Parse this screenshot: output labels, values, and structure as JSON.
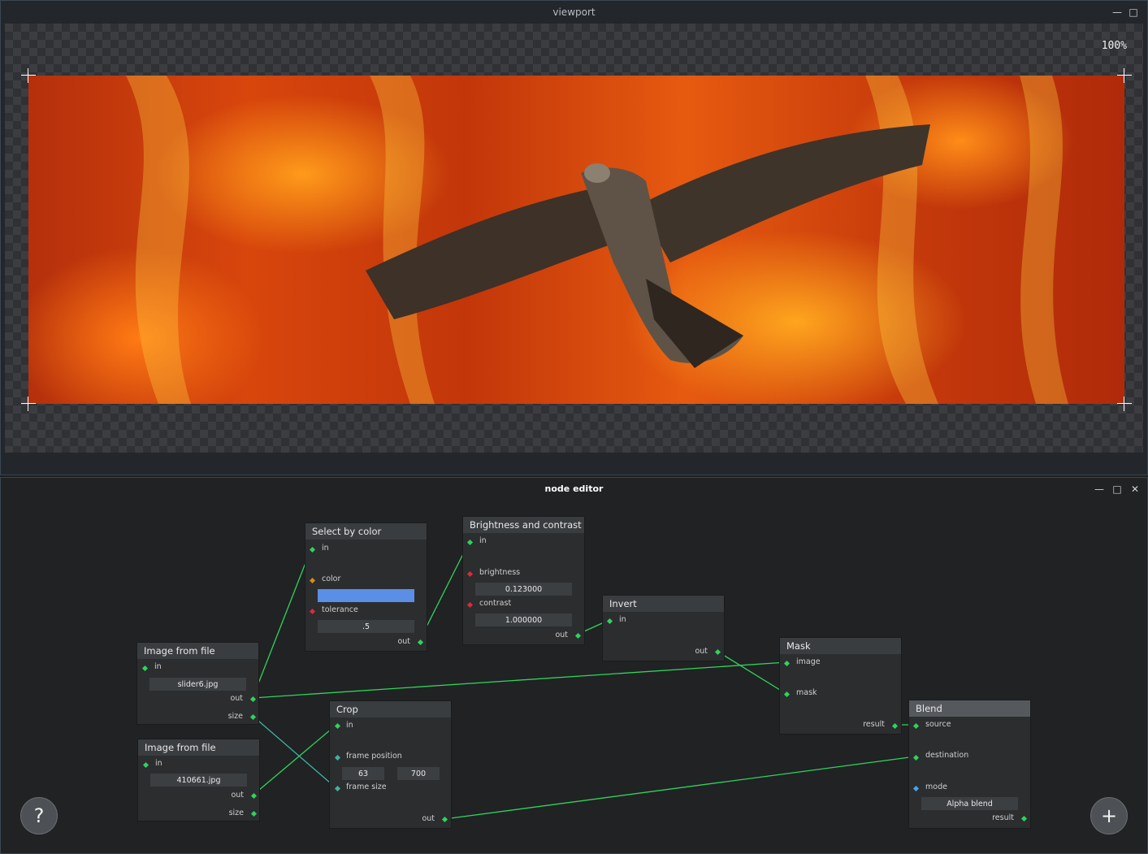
{
  "viewport": {
    "title": "viewport",
    "zoom": "100%"
  },
  "editor": {
    "title": "node editor",
    "nodes": {
      "img1": {
        "title": "Image from file",
        "in": "in",
        "file": "slider6.jpg",
        "out": "out",
        "size": "size"
      },
      "img2": {
        "title": "Image from file",
        "in": "in",
        "file": "410661.jpg",
        "out": "out",
        "size": "size"
      },
      "select": {
        "title": "Select by color",
        "in": "in",
        "color": "color",
        "color_value": "#5b8fe6",
        "tolerance": "tolerance",
        "tolerance_value": ".5",
        "out": "out"
      },
      "bc": {
        "title": "Brightness and contrast",
        "in": "in",
        "brightness": "brightness",
        "brightness_value": "0.123000",
        "contrast": "contrast",
        "contrast_value": "1.000000",
        "out": "out"
      },
      "crop": {
        "title": "Crop",
        "in": "in",
        "frame_position": "frame position",
        "pos_x": "63",
        "pos_y": "700",
        "frame_size": "frame size",
        "out": "out"
      },
      "invert": {
        "title": "Invert",
        "in": "in",
        "out": "out"
      },
      "mask": {
        "title": "Mask",
        "image": "image",
        "mask": "mask",
        "result": "result"
      },
      "blend": {
        "title": "Blend",
        "source": "source",
        "destination": "destination",
        "mode": "mode",
        "mode_value": "Alpha blend",
        "result": "result"
      }
    },
    "help_button": "?",
    "add_button": "+"
  },
  "colors": {
    "wire": "#2fd45a",
    "wire_size": "#3fb2a0",
    "selection": "#5b8fe6"
  },
  "icons": [
    "minimize-icon",
    "maximize-icon",
    "close-icon",
    "help-icon",
    "add-icon"
  ]
}
